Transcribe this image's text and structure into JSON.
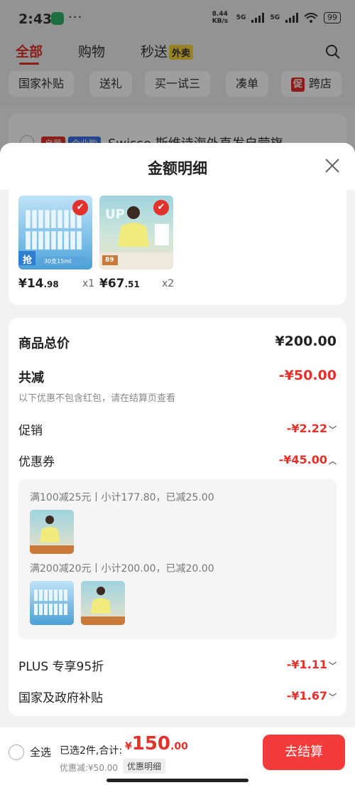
{
  "status_bar": {
    "time": "2:43",
    "dots": "···",
    "net_speed": "8.44 KB/s",
    "net_5g_a": "5G",
    "net_5g_b": "5G",
    "battery": "99"
  },
  "top_tabs": [
    {
      "label": "全部",
      "active": true
    },
    {
      "label": "购物",
      "active": false
    },
    {
      "label": "秒送",
      "active": false,
      "badge": "外卖"
    }
  ],
  "chips": [
    "国家补贴",
    "送礼",
    "买一试三",
    "凑单",
    "跨店"
  ],
  "chip_promo_badge": "促",
  "bg_item": {
    "tag1": "自营",
    "tag2": "企业购",
    "title": "Swisse 斯维诗海外直发自营旗"
  },
  "sheet": {
    "title": "金额明细",
    "products": [
      {
        "price_int": "¥14",
        "price_dec": ".98",
        "qty": "x1",
        "thumb_text": "抢",
        "thumb_sub": "30支15ml"
      },
      {
        "price_int": "¥67",
        "price_dec": ".51",
        "qty": "x2",
        "thumb_text": "UP",
        "thumb_sub": "89"
      }
    ],
    "total_label": "商品总价",
    "total_value": "¥200.00",
    "discount_label": "共减",
    "discount_value": "-¥50.00",
    "discount_note": "以下优惠不包含红包，请在结算页查看",
    "promo_label": "促销",
    "promo_value": "-¥2.22",
    "coupon_label": "优惠券",
    "coupon_value": "-¥45.00",
    "coupon_lines": [
      "满100减25元丨小计177.80，已减25.00",
      "满200减20元丨小计200.00，已减20.00"
    ],
    "plus_label": "PLUS 专享95折",
    "plus_value": "-¥1.11",
    "subsidy_label": "国家及政府补贴",
    "subsidy_value": "-¥1.67"
  },
  "bottom_bar": {
    "select_all": "全选",
    "selected_text": "已选2件,合计:",
    "currency": "¥",
    "total_int": "150",
    "total_dec": ".00",
    "saved_text": "优惠减:¥50.00",
    "detail_btn": "优惠明细",
    "pay_btn": "去结算"
  },
  "colors": {
    "accent": "#e3312b",
    "pay_button": "#f43b3b"
  }
}
